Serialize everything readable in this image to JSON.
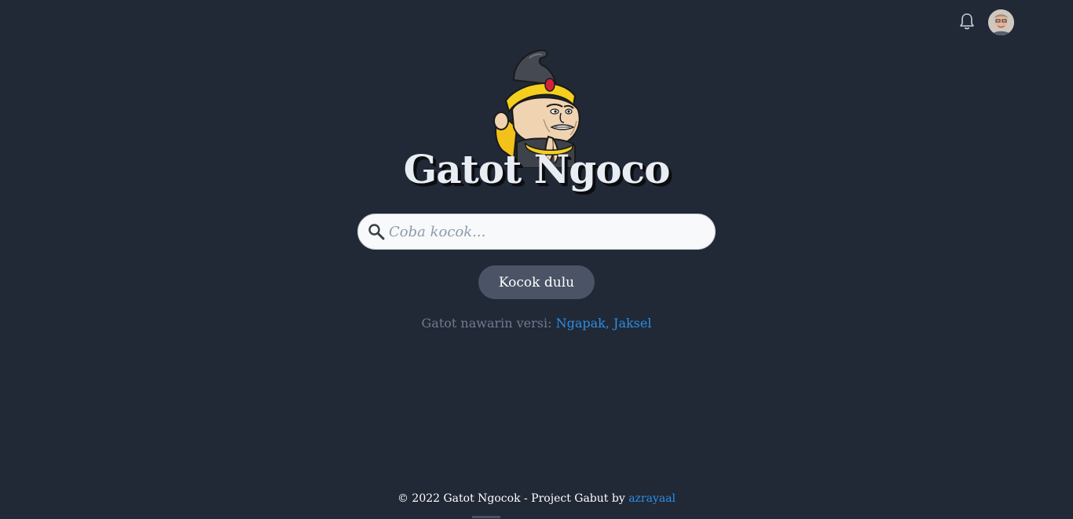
{
  "header": {
    "notification_icon": "bell-icon",
    "avatar_icon": "user-avatar"
  },
  "hero": {
    "mascot_icon": "wayang-mascot",
    "title": "Gatot Ngoco"
  },
  "search": {
    "placeholder": "Coba kocok...",
    "value": "",
    "icon": "search-icon"
  },
  "action": {
    "button_label": "Kocok dulu"
  },
  "versions": {
    "prefix": "Gatot nawarin versi: ",
    "links": [
      "Ngapak,",
      "Jaksel"
    ]
  },
  "footer": {
    "text": "© 2022 Gatot Ngocok - Project Gabut by ",
    "author": "azrayaal"
  },
  "colors": {
    "background": "#212836",
    "link": "#2c8fe6",
    "button": "#4a5466",
    "muted_text": "#6f7c8e"
  }
}
